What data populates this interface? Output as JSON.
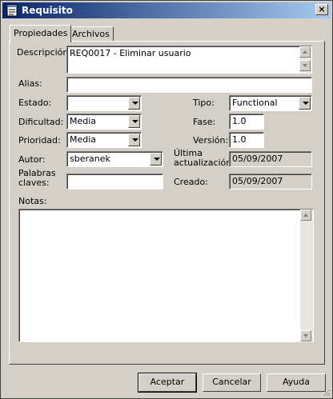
{
  "window": {
    "title": "Requisito",
    "close_glyph": "×"
  },
  "tabs": [
    {
      "label": "Propiedades"
    },
    {
      "label": "Archivos"
    }
  ],
  "form": {
    "descripcion": {
      "label": "Descripción:",
      "value": "REQ0017 - Eliminar usuario"
    },
    "alias": {
      "label": "Alias:",
      "value": ""
    },
    "estado": {
      "label": "Estado:",
      "value": ""
    },
    "tipo": {
      "label": "Tipo:",
      "value": "Functional"
    },
    "dificultad": {
      "label": "Dificultad:",
      "value": "Media"
    },
    "fase": {
      "label": "Fase:",
      "value": "1.0"
    },
    "prioridad": {
      "label": "Prioridad:",
      "value": "Media"
    },
    "version": {
      "label": "Versión:",
      "value": "1.0"
    },
    "autor": {
      "label": "Autor:",
      "value": "sberanek"
    },
    "ultima_actualizacion": {
      "label_line1": "Última",
      "label_line2": "actualización",
      "value": "05/09/2007"
    },
    "palabras_claves": {
      "label_line1": "Palabras",
      "label_line2": "claves:",
      "value": ""
    },
    "creado": {
      "label": "Creado:",
      "value": "05/09/2007"
    },
    "notas": {
      "label": "Notas:",
      "value": ""
    }
  },
  "buttons": {
    "accept": "Aceptar",
    "cancel": "Cancelar",
    "help": "Ayuda"
  },
  "icons": {
    "app": "document-icon",
    "close": "close-icon",
    "grip": "resize-grip-icon"
  }
}
